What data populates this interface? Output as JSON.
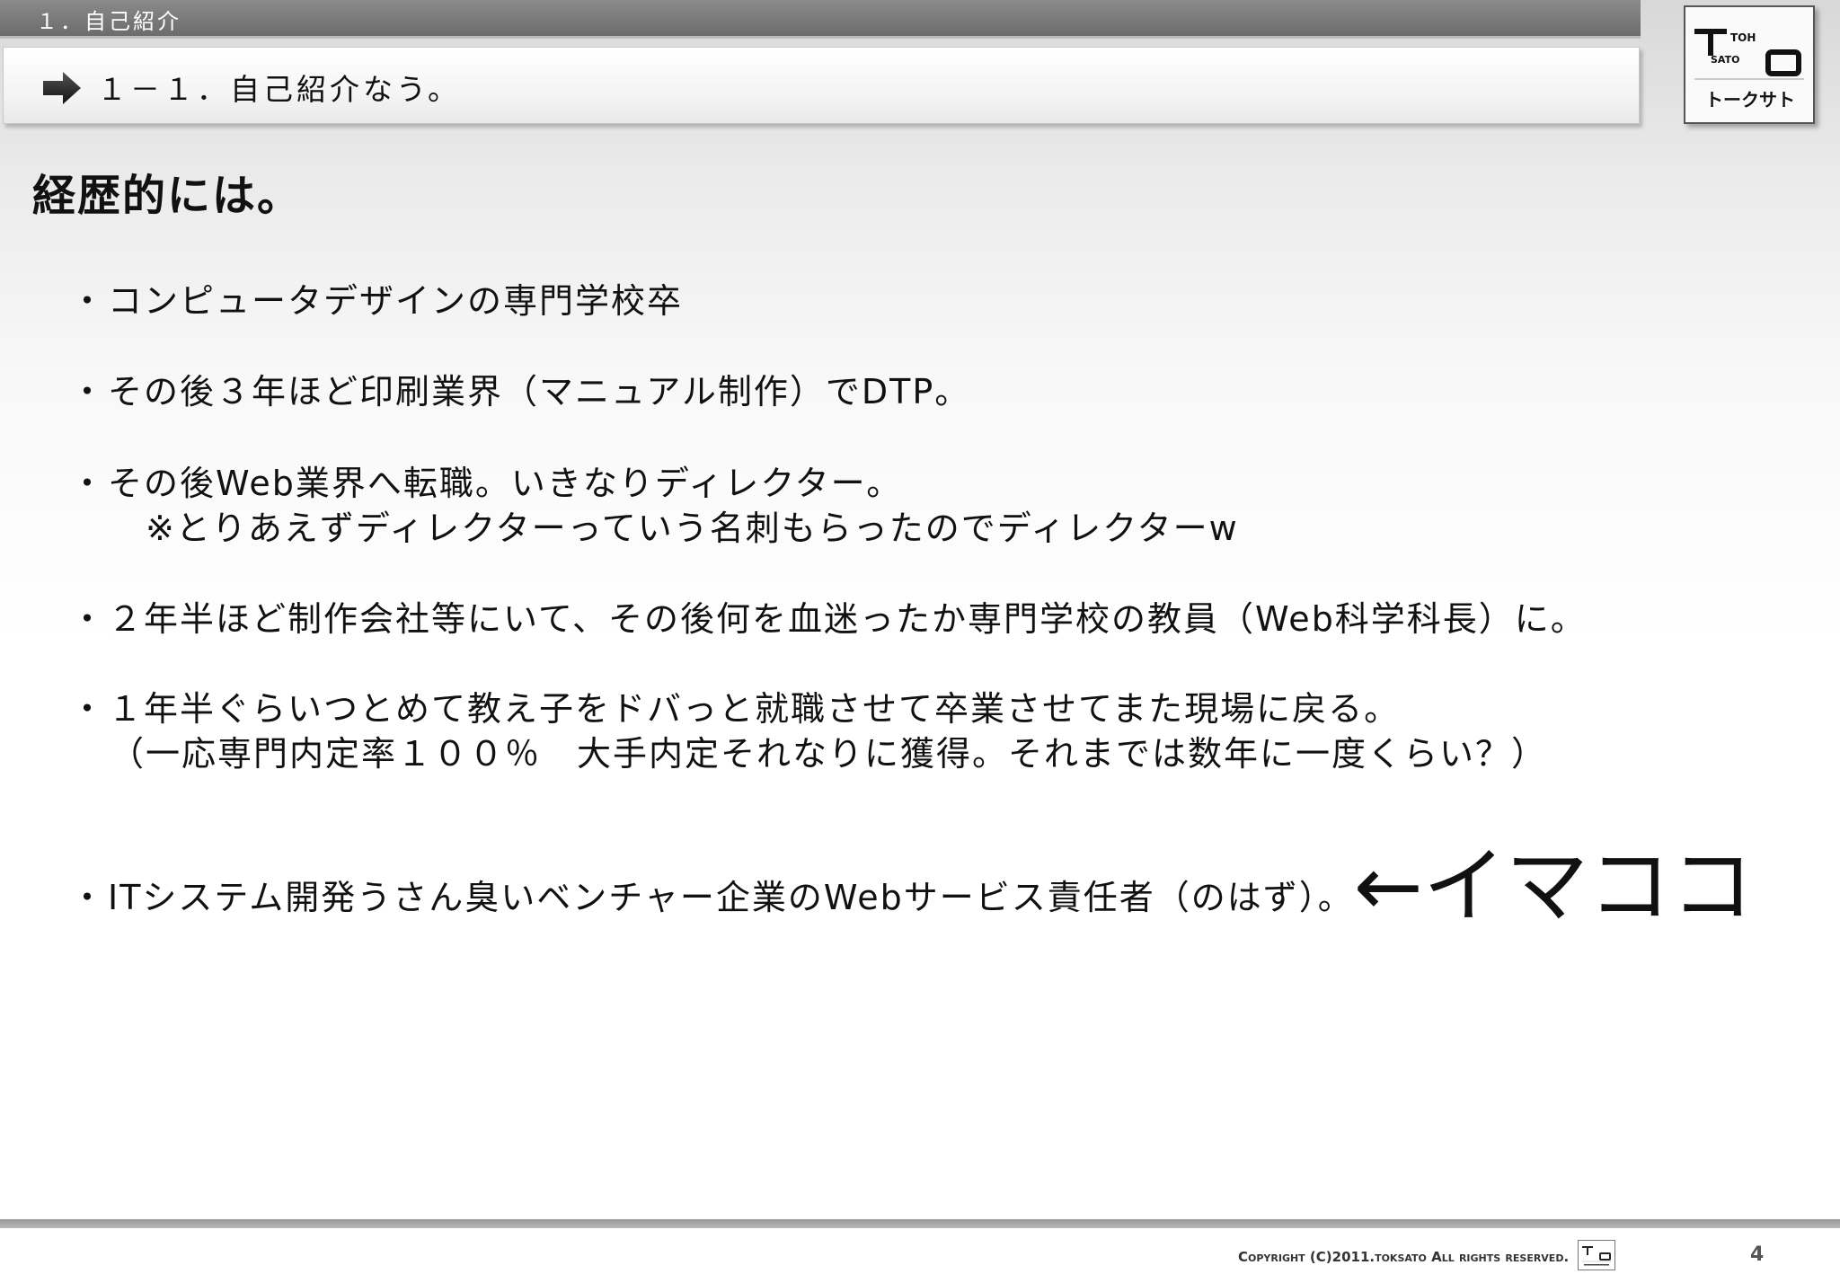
{
  "section": {
    "label": "１．自己紹介"
  },
  "subsection": {
    "title": "１－１．自己紹介なう。"
  },
  "logo": {
    "line1": "TOH",
    "line2": "SATO",
    "katakana": "トークサト"
  },
  "slide": {
    "title": "経歴的には。",
    "bullet_marker": "・",
    "bullets": [
      {
        "text": "コンピュータデザインの専門学校卒"
      },
      {
        "text": "その後３年ほど印刷業界（マニュアル制作）でDTP。"
      },
      {
        "text": "その後Web業界へ転職。いきなりディレクター。",
        "sub": "※とりあえずディレクターっていう名刺もらったのでディレクターw"
      },
      {
        "text": "２年半ほど制作会社等にいて、その後何を血迷ったか専門学校の教員（Web科学科長）に。"
      },
      {
        "text": "１年半ぐらいつとめて教え子をドバっと就職させて卒業させてまた現場に戻る。",
        "sub": "（一応専門内定率１００％　大手内定それなりに獲得。それまでは数年に一度くらい？）"
      },
      {
        "text": "ITシステム開発うさん臭いベンチャー企業のWebサービス責任者（のはず）。",
        "emphasis": "←イマココ"
      }
    ]
  },
  "footer": {
    "copyright": "Copyright (C)2011.toksato All rights reserved.",
    "page_number": "4"
  }
}
